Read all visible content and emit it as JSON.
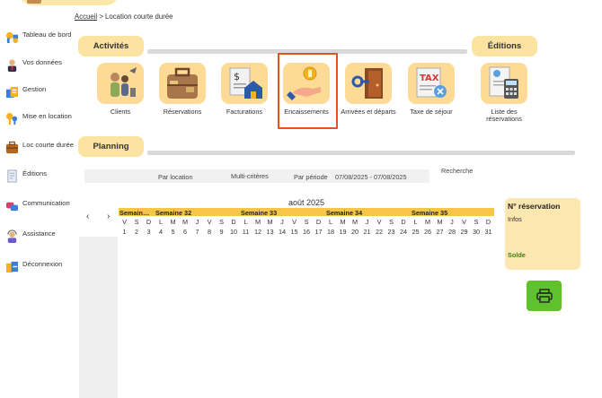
{
  "breadcrumb": {
    "home": "Accueil",
    "separator": ">",
    "current": "Location courte durée"
  },
  "sidebar": {
    "items": [
      {
        "label": "Tableau de bord",
        "icon": "dashboard-icon"
      },
      {
        "label": "Vos données",
        "icon": "user-icon"
      },
      {
        "label": "Gestion",
        "icon": "management-icon"
      },
      {
        "label": "Mise en location",
        "icon": "keys-icon"
      },
      {
        "label": "Loc courte durée",
        "icon": "suitcase-icon"
      },
      {
        "label": "Éditions",
        "icon": "document-icon"
      },
      {
        "label": "Communication",
        "icon": "chat-icon"
      },
      {
        "label": "Assistance",
        "icon": "support-icon"
      },
      {
        "label": "Déconnexion",
        "icon": "logout-icon"
      }
    ]
  },
  "sections": {
    "activites": "Activités",
    "editions": "Éditions",
    "planning": "Planning"
  },
  "tiles": [
    {
      "label": "Clients",
      "icon": "clients-icon"
    },
    {
      "label": "Réservations",
      "icon": "luggage-icon"
    },
    {
      "label": "Facturations",
      "icon": "invoice-icon"
    },
    {
      "label": "Encaissements",
      "icon": "coin-hand-icon"
    },
    {
      "label": "Arrivées et départs",
      "icon": "door-key-icon"
    },
    {
      "label": "Taxe de séjour",
      "icon": "tax-icon"
    },
    {
      "label": "Liste des réservations",
      "icon": "calculator-icon"
    }
  ],
  "filters": {
    "by_location": "Par location",
    "multi": "Multi-critères",
    "by_period": "Par période",
    "period_value": "07/08/2025 - 07/08/2025",
    "search": "Recherche"
  },
  "calendar": {
    "month": "août 2025",
    "prev": "‹",
    "next": "›",
    "weeks": [
      "Semain…",
      "Semaine 32",
      "Semaine 33",
      "Semaine 34",
      "Semaine 35"
    ],
    "days": [
      "V",
      "S",
      "D",
      "L",
      "M",
      "M",
      "J",
      "V",
      "S",
      "D",
      "L",
      "M",
      "M",
      "J",
      "V",
      "S",
      "D",
      "L",
      "M",
      "M",
      "J",
      "V",
      "S",
      "D",
      "L",
      "M",
      "M",
      "J",
      "V",
      "S",
      "D"
    ],
    "dates": [
      "1",
      "2",
      "3",
      "4",
      "5",
      "6",
      "7",
      "8",
      "9",
      "10",
      "11",
      "12",
      "13",
      "14",
      "15",
      "16",
      "17",
      "18",
      "19",
      "20",
      "21",
      "22",
      "23",
      "24",
      "25",
      "26",
      "27",
      "28",
      "29",
      "30",
      "31"
    ]
  },
  "reservation": {
    "title": "N° réservation",
    "infos": "Infos",
    "solde": "Solde"
  },
  "colors": {
    "accent": "#fde3a0",
    "highlight": "#e0541f",
    "week": "#f7c548",
    "print": "#5fc12b",
    "solde": "#3f7d17"
  }
}
